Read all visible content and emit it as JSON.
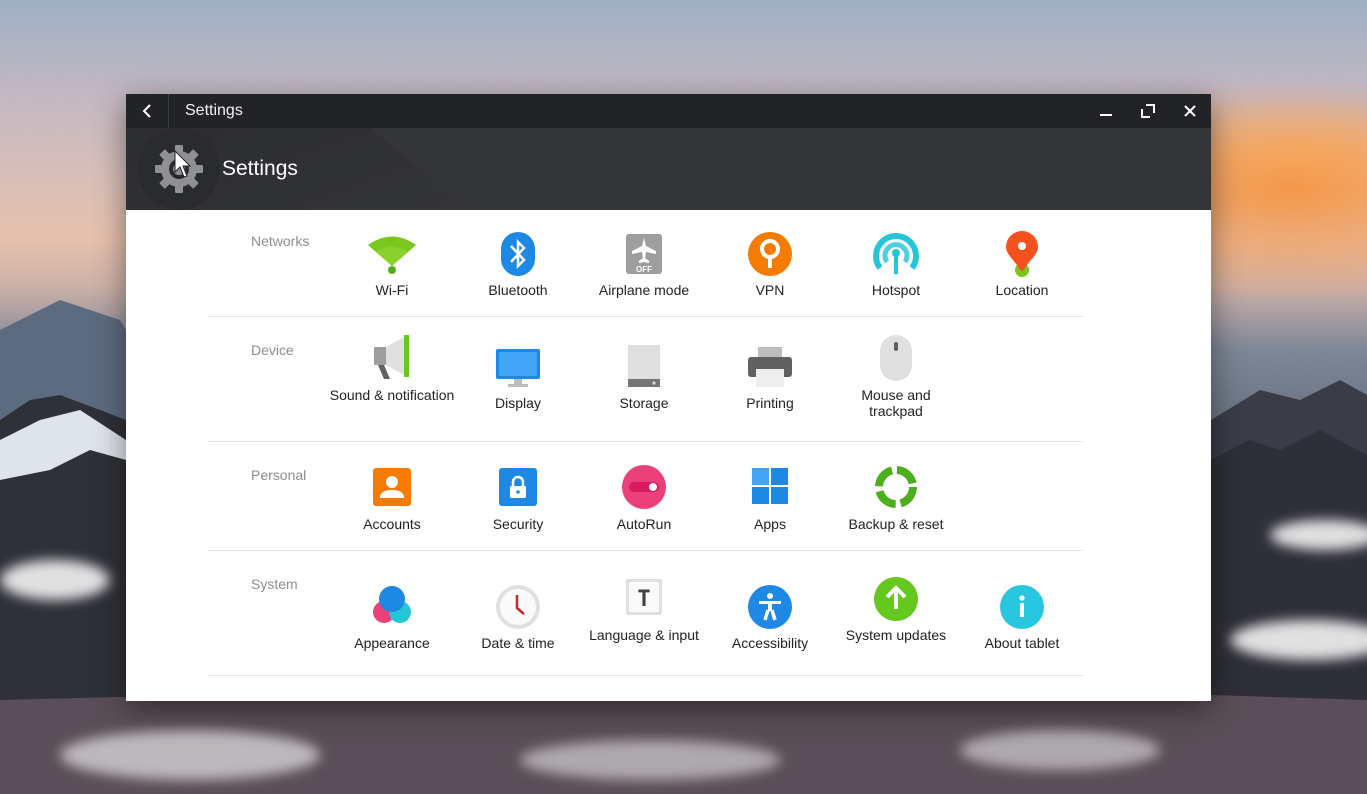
{
  "window": {
    "titlebar_title": "Settings",
    "header_title": "Settings"
  },
  "sections": [
    {
      "label": "Networks",
      "items": [
        {
          "label": "Wi-Fi",
          "icon": "wifi-icon"
        },
        {
          "label": "Bluetooth",
          "icon": "bluetooth-icon"
        },
        {
          "label": "Airplane mode",
          "icon": "airplane-mode-icon",
          "badge": "OFF"
        },
        {
          "label": "VPN",
          "icon": "vpn-icon"
        },
        {
          "label": "Hotspot",
          "icon": "hotspot-icon"
        },
        {
          "label": "Location",
          "icon": "location-icon"
        }
      ]
    },
    {
      "label": "Device",
      "items": [
        {
          "label": "Sound & notification",
          "icon": "megaphone-icon"
        },
        {
          "label": "Display",
          "icon": "monitor-icon"
        },
        {
          "label": "Storage",
          "icon": "storage-icon"
        },
        {
          "label": "Printing",
          "icon": "printer-icon"
        },
        {
          "label": "Mouse and trackpad",
          "icon": "mouse-icon"
        }
      ]
    },
    {
      "label": "Personal",
      "items": [
        {
          "label": "Accounts",
          "icon": "accounts-icon"
        },
        {
          "label": "Security",
          "icon": "lock-icon"
        },
        {
          "label": "AutoRun",
          "icon": "toggle-icon"
        },
        {
          "label": "Apps",
          "icon": "apps-grid-icon"
        },
        {
          "label": "Backup & reset",
          "icon": "backup-icon"
        }
      ]
    },
    {
      "label": "System",
      "items": [
        {
          "label": "Appearance",
          "icon": "appearance-icon"
        },
        {
          "label": "Date & time",
          "icon": "clock-icon"
        },
        {
          "label": "Language & input",
          "icon": "language-icon",
          "glyph": "T"
        },
        {
          "label": "Accessibility",
          "icon": "accessibility-icon"
        },
        {
          "label": "System updates",
          "icon": "system-update-icon"
        },
        {
          "label": "About tablet",
          "icon": "info-icon",
          "glyph": "i"
        }
      ]
    }
  ],
  "colors": {
    "titlebar": "#222326",
    "header": "#343538",
    "wifi": "#7ac81e",
    "bluetooth": "#1e88e5",
    "vpn": "#f57c00",
    "hotspot": "#26c6da",
    "location": "#f4511e",
    "accounts": "#f57c00",
    "autorun": "#ec407a",
    "accessibility": "#1e88e5",
    "updates": "#64c81e",
    "about": "#29c6e0"
  }
}
